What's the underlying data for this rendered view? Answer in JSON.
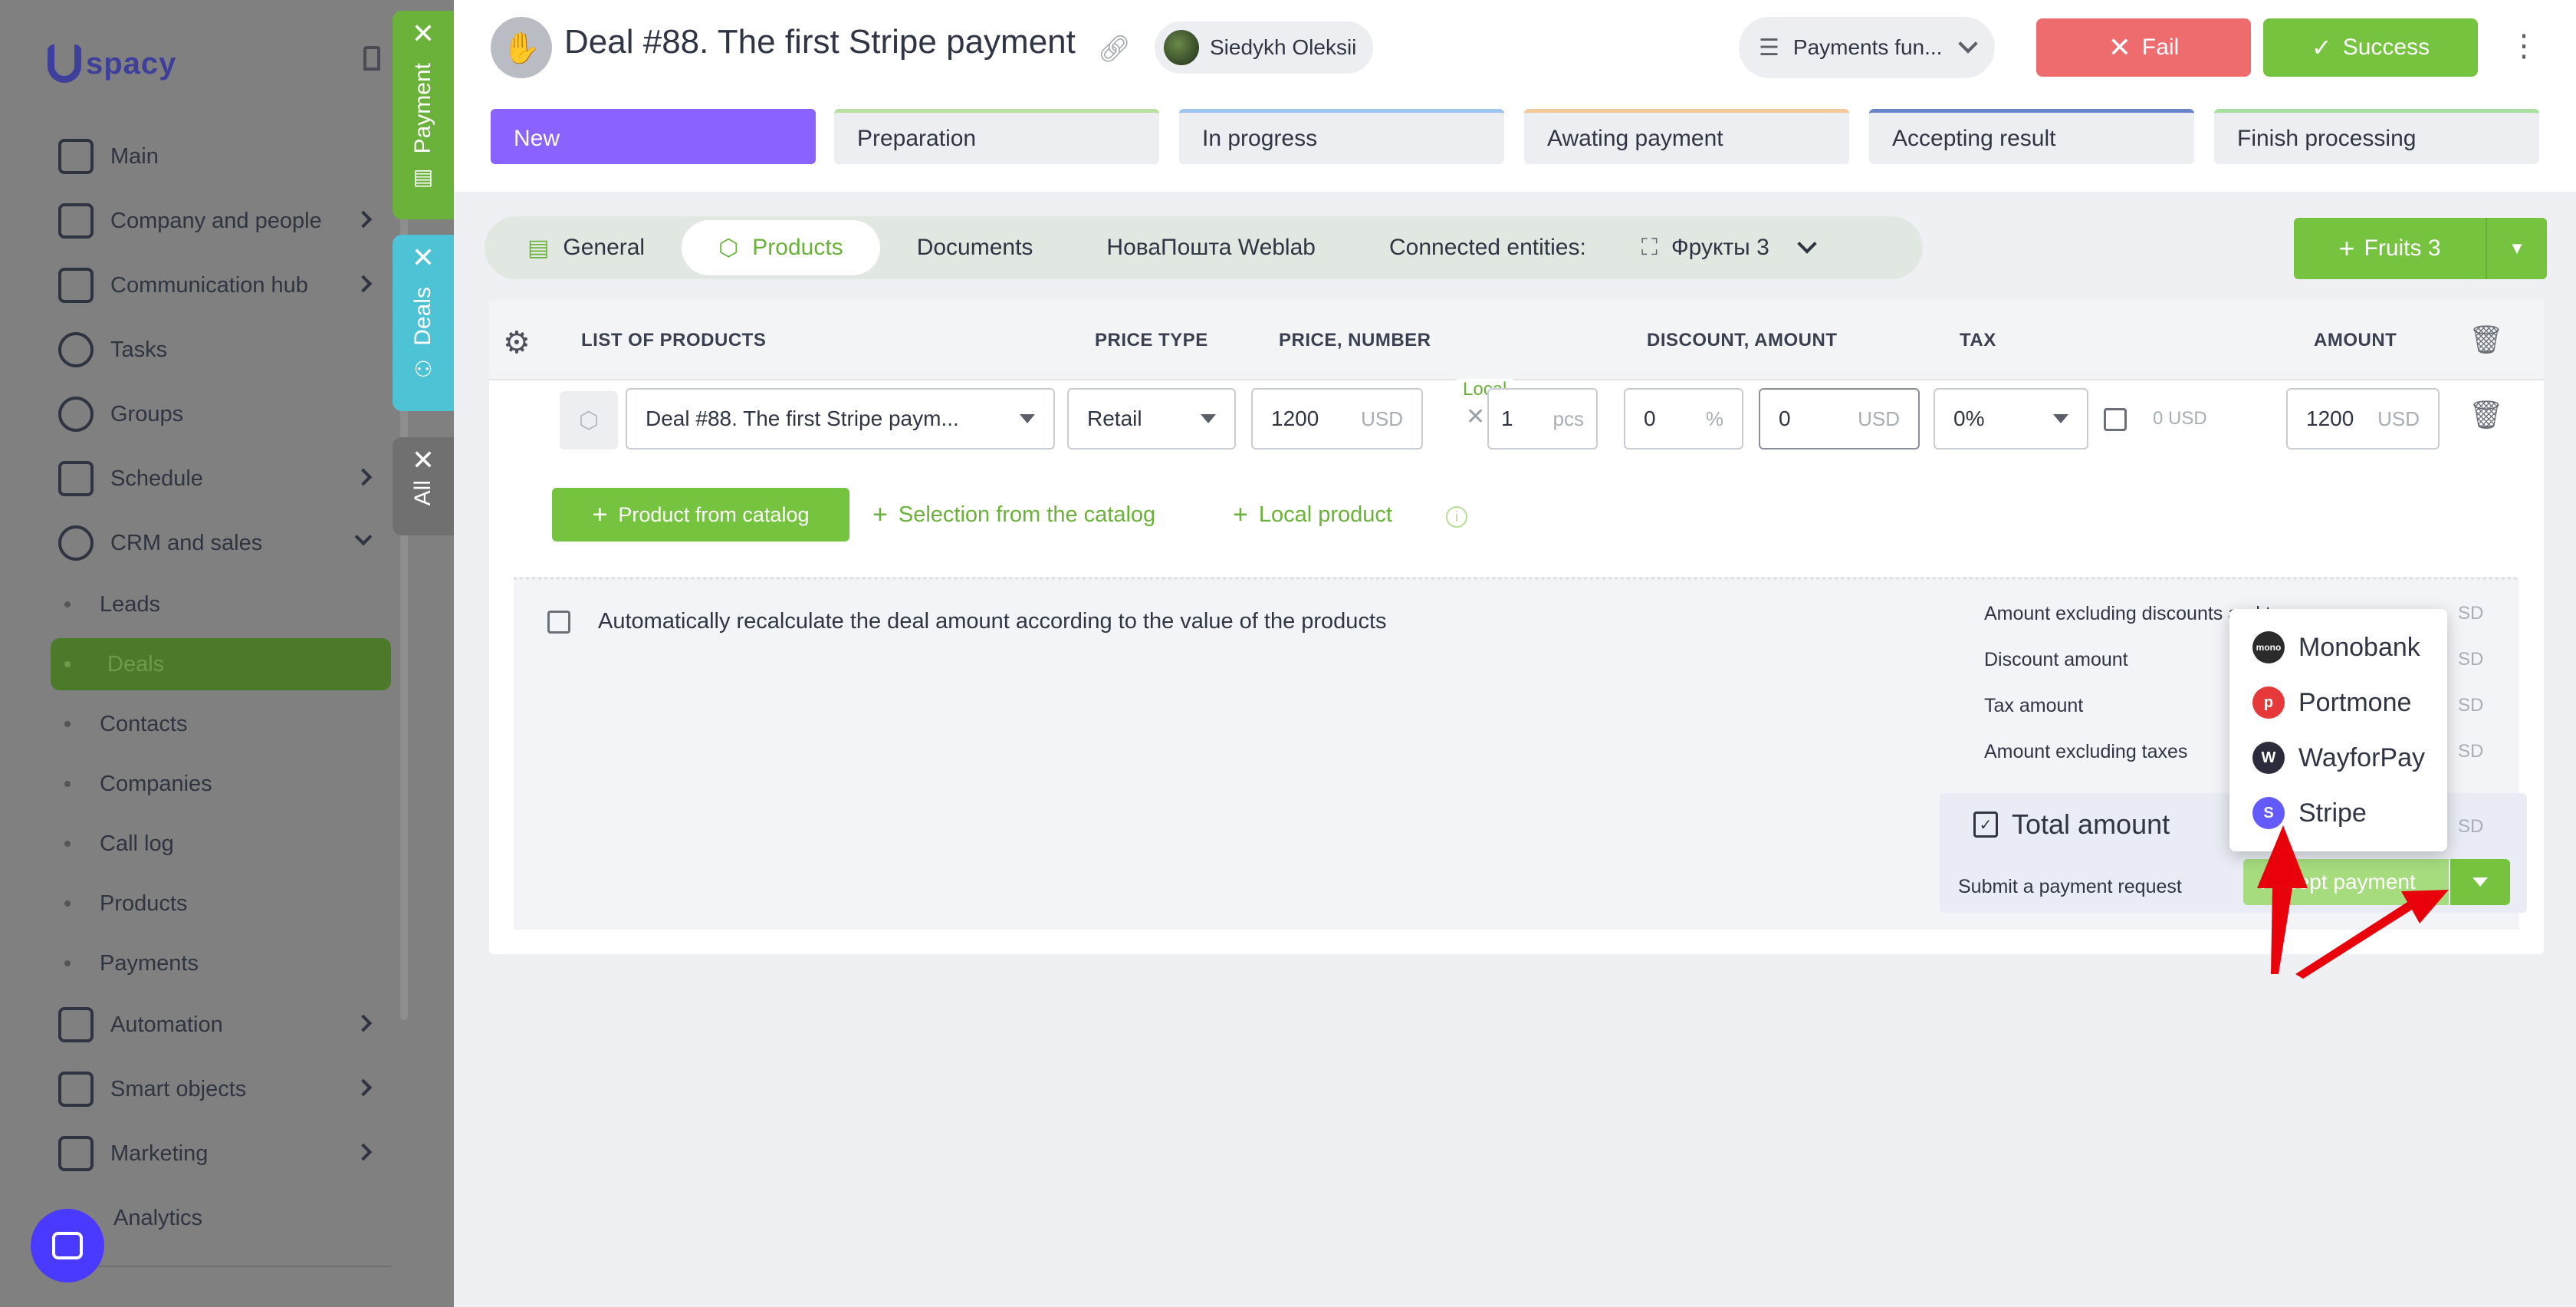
{
  "brand": {
    "logo_text": "spacy",
    "accent": "#76c340",
    "stage_active": "#8a63ff"
  },
  "sidebar": {
    "items": [
      {
        "label": "Main",
        "icon": "home-icon"
      },
      {
        "label": "Company and people",
        "icon": "building-icon"
      },
      {
        "label": "Communication hub",
        "icon": "chat-icon"
      },
      {
        "label": "Tasks",
        "icon": "check-circle-icon"
      },
      {
        "label": "Groups",
        "icon": "users-icon"
      },
      {
        "label": "Schedule",
        "icon": "calendar-icon"
      },
      {
        "label": "CRM and sales",
        "icon": "database-icon"
      },
      {
        "label": "Automation",
        "icon": "lightning-icon"
      },
      {
        "label": "Smart objects",
        "icon": "scan-icon"
      },
      {
        "label": "Marketing",
        "icon": "megaphone-icon"
      },
      {
        "label": "Analytics",
        "icon": "chart-icon"
      }
    ],
    "crm_sub": [
      "Leads",
      "Deals",
      "Contacts",
      "Companies",
      "Call log",
      "Products",
      "Payments"
    ],
    "active_sub": "Deals"
  },
  "side_tabs": {
    "payment": "Payment",
    "deals": "Deals",
    "all": "All"
  },
  "header": {
    "title": "Deal #88. The first Stripe payment",
    "owner": "Siedykh Oleksii",
    "funnel": "Payments fun...",
    "fail_label": "Fail",
    "success_label": "Success"
  },
  "stages": [
    {
      "label": "New",
      "color": "#8a63ff"
    },
    {
      "label": "Preparation",
      "color": "#b8e0a0"
    },
    {
      "label": "In progress",
      "color": "#9cc4ee"
    },
    {
      "label": "Awating payment",
      "color": "#f3c89a"
    },
    {
      "label": "Accepting result",
      "color": "#6a84c8"
    },
    {
      "label": "Finish processing",
      "color": "#a8e0a0"
    }
  ],
  "tabs": [
    "General",
    "Products",
    "Documents",
    "НоваПошта Weblab",
    "Connected entities:",
    "Фрукты 3"
  ],
  "fruits_button": "Fruits 3",
  "table": {
    "headers": [
      "LIST OF PRODUCTS",
      "PRICE TYPE",
      "PRICE, NUMBER",
      "DISCOUNT, AMOUNT",
      "TAX",
      "AMOUNT"
    ],
    "row": {
      "product": "Deal #88. The first Stripe paym...",
      "local_tag": "Local",
      "price_type": "Retail",
      "price": "1200",
      "price_unit": "USD",
      "qty": "1",
      "qty_unit": "pcs",
      "discount_pct": "0",
      "discount_pct_unit": "%",
      "discount_amt": "0",
      "discount_amt_unit": "USD",
      "tax": "0%",
      "tax_amount": "0 USD",
      "amount": "1200",
      "amount_unit": "USD"
    }
  },
  "actions": {
    "catalog": "Product from catalog",
    "selection": "Selection from the catalog",
    "local": "Local product"
  },
  "summary": {
    "auto_recalc": "Automatically recalculate the deal amount according to the value of the products",
    "lines": [
      "Amount excluding discounts and ta",
      "Discount amount",
      "Tax amount",
      "Amount excluding taxes"
    ],
    "line_tail": "SD",
    "total_label": "Total amount",
    "submit_label": "Submit a payment request",
    "accept_label": "Accept payment"
  },
  "payment_menu": [
    {
      "label": "Monobank",
      "color": "#2b2b2b",
      "glyph": "m"
    },
    {
      "label": "Portmone",
      "color": "#e5393a",
      "glyph": "p"
    },
    {
      "label": "WayforPay",
      "color": "#2b2b3b",
      "glyph": "W"
    },
    {
      "label": "Stripe",
      "color": "#635bff",
      "glyph": "S"
    }
  ]
}
